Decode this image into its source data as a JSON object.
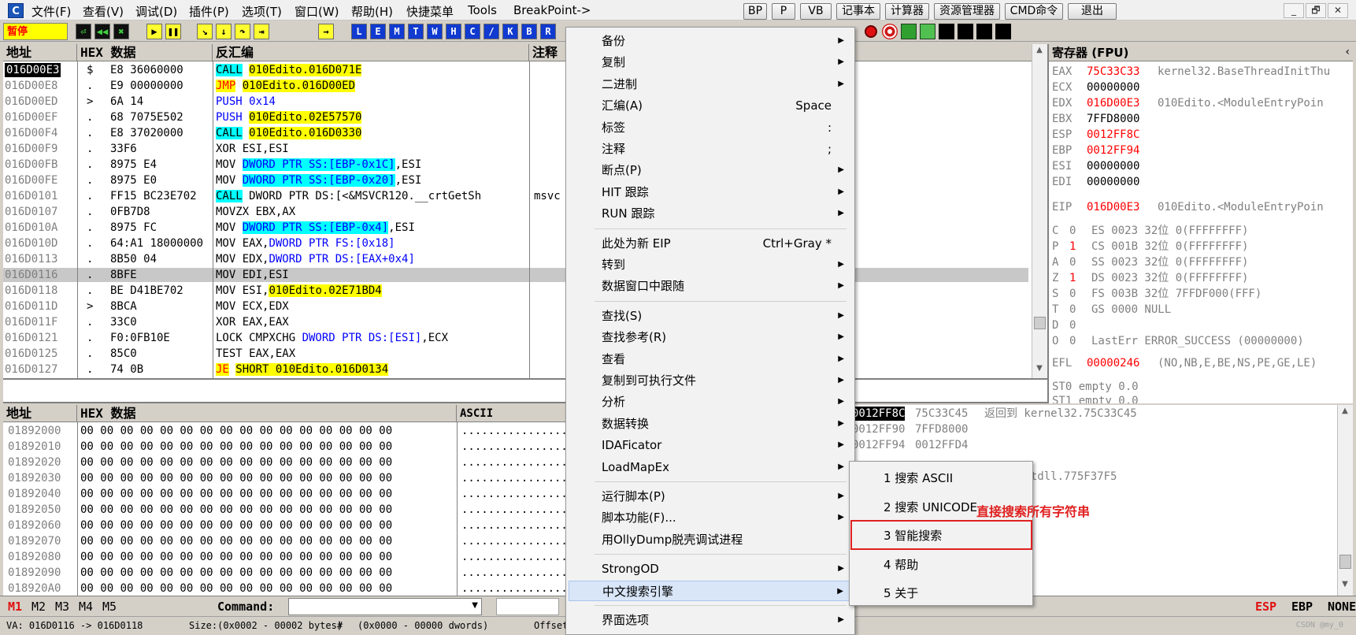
{
  "menubar": {
    "app_icon": "C",
    "items": [
      "文件(F)",
      "查看(V)",
      "调试(D)",
      "插件(P)",
      "选项(T)",
      "窗口(W)",
      "帮助(H)",
      "快捷菜单",
      "Tools",
      "BreakPoint->"
    ],
    "buttons": [
      "BP",
      "P",
      "VB",
      "记事本",
      "计算器",
      "资源管理器",
      "CMD命令",
      "退出"
    ],
    "window_controls": [
      "_",
      "🗗",
      "✕"
    ]
  },
  "toolbar": {
    "status": "暂停",
    "buttons": [
      "⏎",
      "◀◀",
      "✖",
      "▶",
      "❚❚",
      "↘",
      "↓",
      "↷",
      "⇥",
      "→",
      "L",
      "E",
      "M",
      "T",
      "W",
      "H",
      "C",
      "/",
      "K",
      "B",
      "R"
    ]
  },
  "disasm": {
    "headers": {
      "addr": "地址",
      "hex": "HEX 数据",
      "asm": "反汇编",
      "comment": "注释"
    },
    "rows": [
      {
        "addr": "016D00E3",
        "m": "$",
        "hex": "E8 36060000",
        "a": [
          {
            "t": "CALL",
            "s": "cy"
          },
          {
            "t": " "
          },
          {
            "t": "010Edito.016D071E",
            "s": "ye"
          }
        ],
        "cur": true
      },
      {
        "addr": "016D00E8",
        "m": ".",
        "hex": "E9 00000000",
        "a": [
          {
            "t": "JMP",
            "s": "ye-red"
          },
          {
            "t": " "
          },
          {
            "t": "010Edito.016D00ED",
            "s": "ye"
          }
        ]
      },
      {
        "addr": "016D00ED",
        "m": ">",
        "hex": "6A 14",
        "a": [
          {
            "t": "PUSH",
            "s": "blue"
          },
          {
            "t": " "
          },
          {
            "t": "0x14",
            "s": "blue"
          }
        ]
      },
      {
        "addr": "016D00EF",
        "m": ".",
        "hex": "68 7075E502",
        "a": [
          {
            "t": "PUSH",
            "s": "blue"
          },
          {
            "t": " "
          },
          {
            "t": "010Edito.02E57570",
            "s": "ye"
          }
        ]
      },
      {
        "addr": "016D00F4",
        "m": ".",
        "hex": "E8 37020000",
        "a": [
          {
            "t": "CALL",
            "s": "cy"
          },
          {
            "t": " "
          },
          {
            "t": "010Edito.016D0330",
            "s": "ye"
          }
        ]
      },
      {
        "addr": "016D00F9",
        "m": ".",
        "hex": "33F6",
        "a": [
          {
            "t": "XOR ESI,ESI"
          }
        ]
      },
      {
        "addr": "016D00FB",
        "m": ".",
        "hex": "8975 E4",
        "a": [
          {
            "t": "MOV "
          },
          {
            "t": "DWORD PTR SS:[EBP-0x1C]",
            "s": "cy-blue"
          },
          {
            "t": ",ESI"
          }
        ]
      },
      {
        "addr": "016D00FE",
        "m": ".",
        "hex": "8975 E0",
        "a": [
          {
            "t": "MOV "
          },
          {
            "t": "DWORD PTR SS:[EBP-0x20]",
            "s": "cy-blue"
          },
          {
            "t": ",ESI"
          }
        ]
      },
      {
        "addr": "016D0101",
        "m": ".",
        "hex": "FF15 BC23E702",
        "a": [
          {
            "t": "CALL",
            "s": "cy"
          },
          {
            "t": " DWORD PTR DS:[<&MSVCR120.__crtGetSh"
          }
        ],
        "comment": "msvc"
      },
      {
        "addr": "016D0107",
        "m": ".",
        "hex": "0FB7D8",
        "a": [
          {
            "t": "MOVZX EBX,AX"
          }
        ]
      },
      {
        "addr": "016D010A",
        "m": ".",
        "hex": "8975 FC",
        "a": [
          {
            "t": "MOV "
          },
          {
            "t": "DWORD PTR SS:[EBP-0x4]",
            "s": "cy-blue"
          },
          {
            "t": ",ESI"
          }
        ]
      },
      {
        "addr": "016D010D",
        "m": ".",
        "hex": "64:A1 18000000",
        "a": [
          {
            "t": "MOV EAX,"
          },
          {
            "t": "DWORD PTR FS:[0x18]",
            "s": "blue"
          }
        ]
      },
      {
        "addr": "016D0113",
        "m": ".",
        "hex": "8B50 04",
        "a": [
          {
            "t": "MOV EDX,"
          },
          {
            "t": "DWORD PTR DS:[EAX+0x4]",
            "s": "blue"
          }
        ]
      },
      {
        "addr": "016D0116",
        "m": ".",
        "hex": "8BFE",
        "a": [
          {
            "t": "MOV EDI,ESI"
          }
        ],
        "sel": true
      },
      {
        "addr": "016D0118",
        "m": ".",
        "hex": "BE D41BE702",
        "a": [
          {
            "t": "MOV ESI,"
          },
          {
            "t": "010Edito.02E71BD4",
            "s": "ye"
          }
        ]
      },
      {
        "addr": "016D011D",
        "m": ">",
        "hex": "8BCA",
        "a": [
          {
            "t": "MOV ECX,EDX"
          }
        ]
      },
      {
        "addr": "016D011F",
        "m": ".",
        "hex": "33C0",
        "a": [
          {
            "t": "XOR EAX,EAX"
          }
        ]
      },
      {
        "addr": "016D0121",
        "m": ".",
        "hex": "F0:0FB10E",
        "a": [
          {
            "t": "LOCK CMPXCHG "
          },
          {
            "t": "DWORD PTR DS:[ESI]",
            "s": "blue"
          },
          {
            "t": ",ECX"
          }
        ]
      },
      {
        "addr": "016D0125",
        "m": ".",
        "hex": "85C0",
        "a": [
          {
            "t": "TEST EAX,EAX"
          }
        ]
      },
      {
        "addr": "016D0127",
        "m": ".",
        "hex": "74 0B",
        "a": [
          {
            "t": "JE",
            "s": "ye-red"
          },
          {
            "t": " "
          },
          {
            "t": "SHORT 010Edito.016D0134",
            "s": "ye"
          }
        ]
      }
    ]
  },
  "registers": {
    "title": "寄存器 (FPU)",
    "rows": [
      {
        "n": "EAX",
        "v": "75C33C33",
        "d": "kernel32.BaseThreadInitThu",
        "red": true
      },
      {
        "n": "ECX",
        "v": "00000000",
        "d": ""
      },
      {
        "n": "EDX",
        "v": "016D00E3",
        "d": "010Edito.<ModuleEntryPoin",
        "red": true
      },
      {
        "n": "EBX",
        "v": "7FFD8000",
        "d": ""
      },
      {
        "n": "ESP",
        "v": "0012FF8C",
        "d": "",
        "red": true
      },
      {
        "n": "EBP",
        "v": "0012FF94",
        "d": "",
        "red": true
      },
      {
        "n": "ESI",
        "v": "00000000",
        "d": ""
      },
      {
        "n": "EDI",
        "v": "00000000",
        "d": ""
      }
    ],
    "eip": {
      "n": "EIP",
      "v": "016D00E3",
      "d": "010Edito.<ModuleEntryPoin"
    },
    "flags": [
      {
        "f": "C",
        "b": "0",
        "seg": "ES 0023 32位 0(FFFFFFFF)"
      },
      {
        "f": "P",
        "b": "1",
        "seg": "CS 001B 32位 0(FFFFFFFF)",
        "red": true
      },
      {
        "f": "A",
        "b": "0",
        "seg": "SS 0023 32位 0(FFFFFFFF)"
      },
      {
        "f": "Z",
        "b": "1",
        "seg": "DS 0023 32位 0(FFFFFFFF)",
        "red": true
      },
      {
        "f": "S",
        "b": "0",
        "seg": "FS 003B 32位 7FFDF000(FFF)"
      },
      {
        "f": "T",
        "b": "0",
        "seg": "GS 0000 NULL"
      },
      {
        "f": "D",
        "b": "0",
        "seg": ""
      },
      {
        "f": "O",
        "b": "0",
        "seg": "LastErr ERROR_SUCCESS (00000000)"
      }
    ],
    "efl": {
      "n": "EFL",
      "v": "00000246",
      "d": "(NO,NB,E,BE,NS,PE,GE,LE)"
    },
    "st0": "ST0 empty 0.0",
    "st1": "ST1 empty 0.0"
  },
  "dump": {
    "headers": {
      "addr": "地址",
      "hex": "HEX 数据",
      "ascii": "ASCII"
    },
    "hexrow": "00 00 00 00 00 00 00 00 00 00 00 00 00 00 00 00",
    "asciirow": "................",
    "addrs": [
      "01892000",
      "01892010",
      "01892020",
      "01892030",
      "01892040",
      "01892050",
      "01892060",
      "01892070",
      "01892080",
      "01892090",
      "018920A0"
    ]
  },
  "stack": {
    "rows": [
      {
        "a": "0012FF8C",
        "v": "75C33C45",
        "c": "返回到 kernel32.75C33C45",
        "cur": true
      },
      {
        "a": "0012FF90",
        "v": "7FFD8000",
        "c": ""
      },
      {
        "a": "0012FF94",
        "v": "0012FFD4",
        "c": ""
      },
      {
        "a": "0012FF98",
        "v": "775F37F5",
        "c": "返回到 ntdll.775F37F5"
      }
    ]
  },
  "context_menu": {
    "items": [
      {
        "label": "备份",
        "arrow": true
      },
      {
        "label": "复制",
        "arrow": true
      },
      {
        "label": "二进制",
        "arrow": true
      },
      {
        "label": "汇编(A)",
        "shortcut": "Space"
      },
      {
        "label": "标签",
        "shortcut": ":"
      },
      {
        "label": "注释",
        "shortcut": ";"
      },
      {
        "label": "断点(P)",
        "arrow": true
      },
      {
        "label": "HIT 跟踪",
        "arrow": true
      },
      {
        "label": "RUN 跟踪",
        "arrow": true
      },
      {
        "sep": true
      },
      {
        "label": "此处为新 EIP",
        "shortcut": "Ctrl+Gray *"
      },
      {
        "label": "转到",
        "arrow": true
      },
      {
        "label": "数据窗口中跟随",
        "arrow": true
      },
      {
        "sep": true
      },
      {
        "label": "查找(S)",
        "arrow": true
      },
      {
        "label": "查找参考(R)",
        "arrow": true
      },
      {
        "label": "查看",
        "arrow": true
      },
      {
        "label": "复制到可执行文件",
        "arrow": true
      },
      {
        "label": "分析",
        "arrow": true
      },
      {
        "label": "数据转换",
        "arrow": true
      },
      {
        "label": "IDAFicator",
        "arrow": true
      },
      {
        "label": "LoadMapEx",
        "arrow": true
      },
      {
        "sep": true
      },
      {
        "label": "运行脚本(P)",
        "arrow": true
      },
      {
        "label": "脚本功能(F)...",
        "arrow": true
      },
      {
        "label": "用OllyDump脱壳调试进程"
      },
      {
        "sep": true
      },
      {
        "label": "StrongOD",
        "arrow": true
      },
      {
        "label": "中文搜索引擎",
        "arrow": true,
        "selected": true
      },
      {
        "sep": true
      },
      {
        "label": "界面选项",
        "arrow": true
      }
    ]
  },
  "submenu": {
    "items": [
      "1 搜索 ASCII",
      "2 搜索 UNICODE",
      "3 智能搜索",
      "4 帮助",
      "5 关于"
    ]
  },
  "annotation": {
    "text": "直接搜索所有字符串",
    "color": "#e02020"
  },
  "command": {
    "markers": [
      "M1",
      "M2",
      "M3",
      "M4",
      "M5"
    ],
    "label": "Command:",
    "value": "",
    "regs": [
      "ESP",
      "EBP",
      "NONE"
    ]
  },
  "statusbar": {
    "va": "VA: 016D0116 -> 016D0118",
    "size": "Size:(0x0002 - 00002 bytes)",
    "hash": "#",
    "dwords": "(0x0000 - 00000 dwords)",
    "offset": "Offset",
    "watermark": "CSDN @my_0"
  }
}
